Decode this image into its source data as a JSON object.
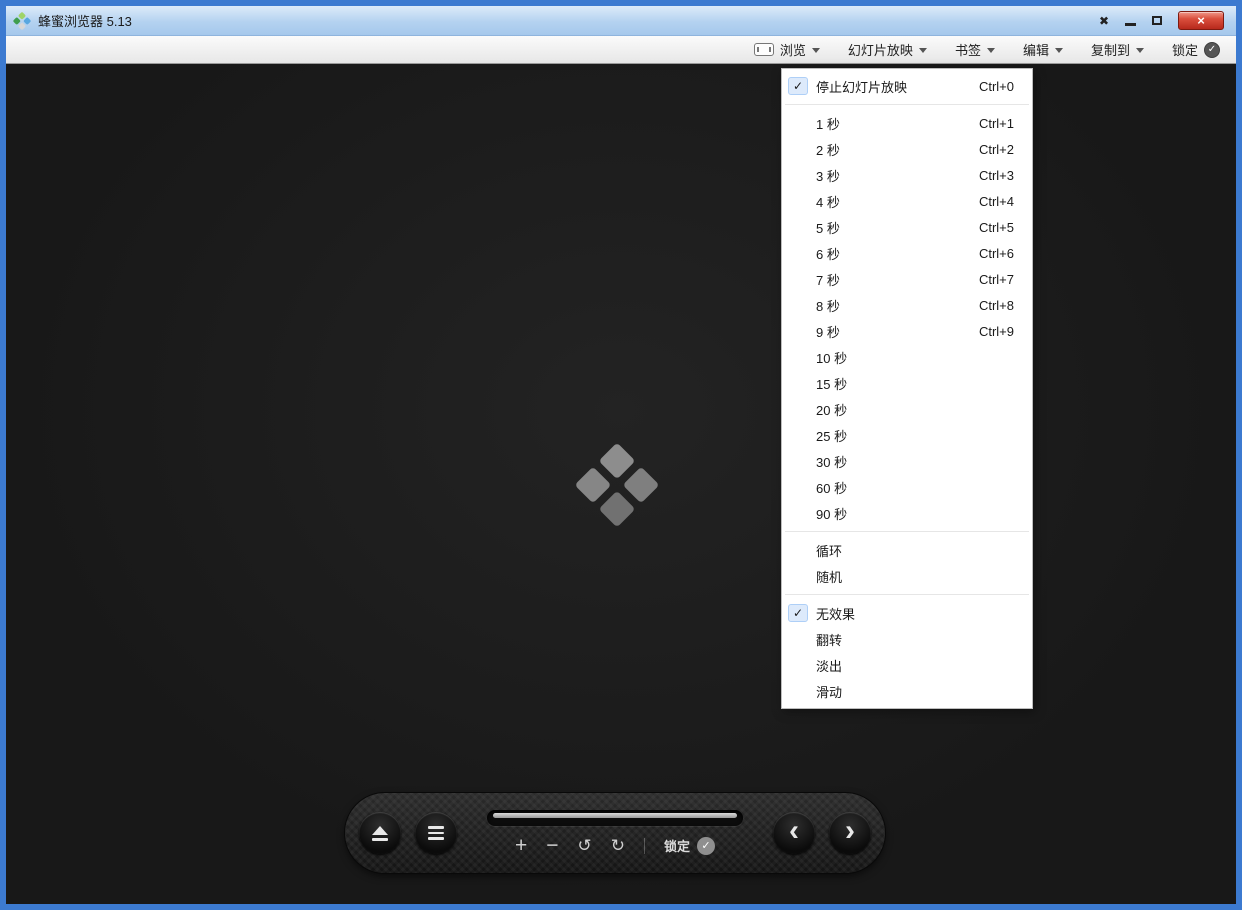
{
  "window": {
    "title": "蜂蜜浏览器 5.13",
    "controls": {
      "pin": "✖",
      "close": "×"
    }
  },
  "toolbar": {
    "browse": "浏览",
    "slideshow": "幻灯片放映",
    "bookmarks": "书签",
    "edit": "编辑",
    "copy_to": "复制到",
    "lock": "锁定"
  },
  "menu": {
    "check_glyph": "✓",
    "items": [
      {
        "label": "停止幻灯片放映",
        "shortcut": "Ctrl+0",
        "checked": true
      },
      {
        "label": "1 秒",
        "shortcut": "Ctrl+1"
      },
      {
        "label": "2 秒",
        "shortcut": "Ctrl+2"
      },
      {
        "label": "3 秒",
        "shortcut": "Ctrl+3"
      },
      {
        "label": "4 秒",
        "shortcut": "Ctrl+4"
      },
      {
        "label": "5 秒",
        "shortcut": "Ctrl+5"
      },
      {
        "label": "6 秒",
        "shortcut": "Ctrl+6"
      },
      {
        "label": "7 秒",
        "shortcut": "Ctrl+7"
      },
      {
        "label": "8 秒",
        "shortcut": "Ctrl+8"
      },
      {
        "label": "9 秒",
        "shortcut": "Ctrl+9"
      },
      {
        "label": "10 秒"
      },
      {
        "label": "15 秒"
      },
      {
        "label": "20 秒"
      },
      {
        "label": "25 秒"
      },
      {
        "label": "30 秒"
      },
      {
        "label": "60 秒"
      },
      {
        "label": "90 秒"
      },
      {
        "label": "循环"
      },
      {
        "label": "随机"
      },
      {
        "label": "无效果",
        "checked": true
      },
      {
        "label": "翻转"
      },
      {
        "label": "淡出"
      },
      {
        "label": "滑动"
      }
    ]
  },
  "osd": {
    "zoom_in": "+",
    "zoom_out": "−",
    "rotate_left": "↺",
    "rotate_right": "↻",
    "lock": "锁定",
    "check_glyph": "✓",
    "prev": "‹",
    "next": "›"
  }
}
